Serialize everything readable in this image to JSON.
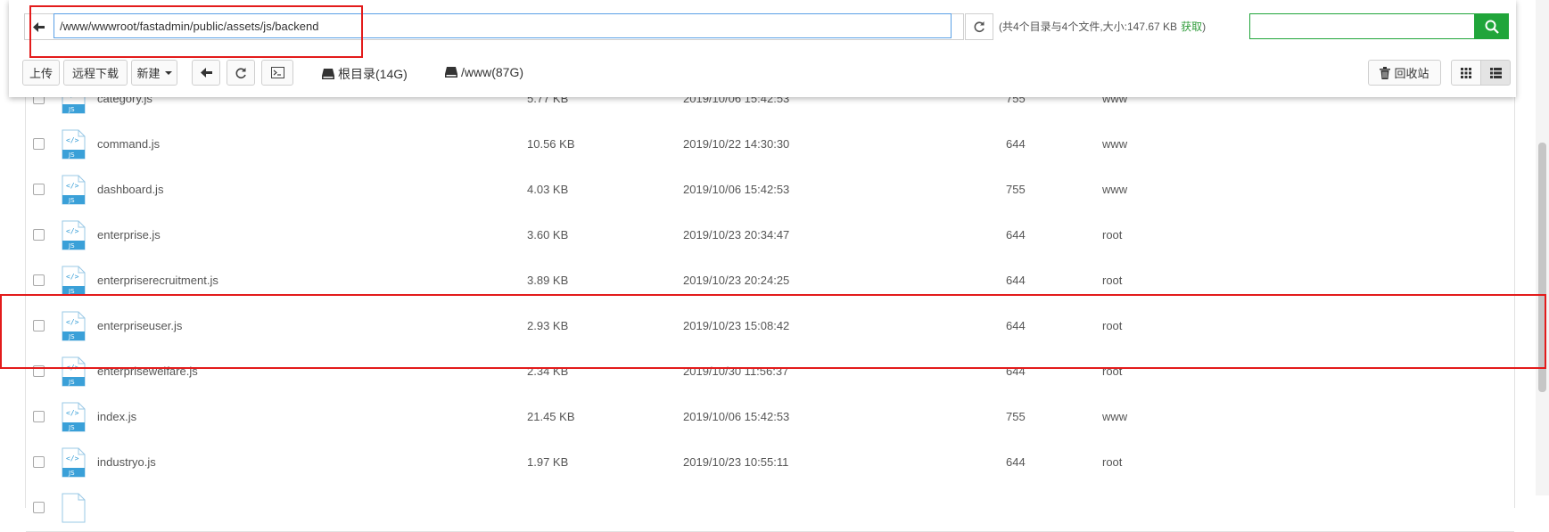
{
  "toolbar": {
    "path": "/www/wwwroot/fastadmin/public/assets/js/backend",
    "summary": "(共4个目录与4个文件,大小:147.67 KB",
    "summary_link": "获取",
    "summary_end": ")",
    "search_placeholder": "",
    "buttons": {
      "upload": "上传",
      "remote_download": "远程下载",
      "new": "新建",
      "recycle": "回收站"
    },
    "disks": [
      "根目录(14G)",
      "/www(87G)"
    ]
  },
  "icons": {
    "back": "arrow-left-icon",
    "refresh": "refresh-icon",
    "terminal": "terminal-icon",
    "search": "search-icon",
    "disk": "hdd-icon",
    "trash": "trash-icon",
    "grid_view": "grid-view-icon",
    "list_view": "list-view-icon",
    "file": "js-file-icon"
  },
  "colors": {
    "accent_green": "#20a53a",
    "link_green": "#2f9c3a",
    "annotation_red": "#e31b1b",
    "js_badge": "#3aa0d8"
  },
  "files": [
    {
      "name": "category.js",
      "size": "5.77 KB",
      "mtime": "2019/10/06 15:42:53",
      "perm": "755",
      "owner": "www"
    },
    {
      "name": "command.js",
      "size": "10.56 KB",
      "mtime": "2019/10/22 14:30:30",
      "perm": "644",
      "owner": "www"
    },
    {
      "name": "dashboard.js",
      "size": "4.03 KB",
      "mtime": "2019/10/06 15:42:53",
      "perm": "755",
      "owner": "www"
    },
    {
      "name": "enterprise.js",
      "size": "3.60 KB",
      "mtime": "2019/10/23 20:34:47",
      "perm": "644",
      "owner": "root"
    },
    {
      "name": "enterpriserecruitment.js",
      "size": "3.89 KB",
      "mtime": "2019/10/23 20:24:25",
      "perm": "644",
      "owner": "root"
    },
    {
      "name": "enterpriseuser.js",
      "size": "2.93 KB",
      "mtime": "2019/10/23 15:08:42",
      "perm": "644",
      "owner": "root"
    },
    {
      "name": "enterprisewelfare.js",
      "size": "2.34 KB",
      "mtime": "2019/10/30 11:56:37",
      "perm": "644",
      "owner": "root"
    },
    {
      "name": "index.js",
      "size": "21.45 KB",
      "mtime": "2019/10/06 15:42:53",
      "perm": "755",
      "owner": "www"
    },
    {
      "name": "industryo.js",
      "size": "1.97 KB",
      "mtime": "2019/10/23 10:55:11",
      "perm": "644",
      "owner": "root"
    },
    {
      "name": "",
      "size": "",
      "mtime": "",
      "perm": "",
      "owner": ""
    }
  ]
}
